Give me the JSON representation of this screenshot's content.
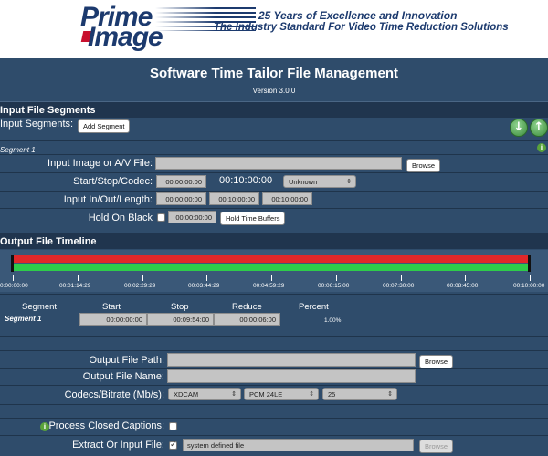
{
  "banner": {
    "logo_line1": "Prime",
    "logo_line2": "Image",
    "tagline1": "25 Years of Excellence and Innovation",
    "tagline2": "The Industry Standard For Video Time Reduction Solutions"
  },
  "page": {
    "title": "Software Time Tailor File Management",
    "version": "Version 3.0.0"
  },
  "input_section": {
    "heading": "Input File Segments",
    "segments_label": "Input Segments:",
    "add_segment_label": "Add Segment",
    "move_down_icon": "↓",
    "move_up_icon": "↑",
    "segment_name": "Segment 1",
    "info_icon": "i",
    "image_av_label": "Input Image or A/V File:",
    "image_av_value": "",
    "browse_label": "Browse",
    "start_stop_label": "Start/Stop/Codec:",
    "start_value": "00:00:00:00",
    "stop_value": "00:10:00:00",
    "codec_value": "Unknown",
    "in_out_label": "Input In/Out/Length:",
    "in_value": "00:00:00:00",
    "out_value": "00:10:00:00",
    "length_value": "00:10:00:00",
    "hold_label": "Hold On Black",
    "hold_value": "00:00:00:00",
    "hold_button_label": "Hold Time Buffers"
  },
  "timeline_section": {
    "heading": "Output File Timeline",
    "ticks": [
      "0:00:00:00",
      "00:01:14:29",
      "00:02:29:29",
      "00:03:44:29",
      "00:04:59:29",
      "00:06:15:00",
      "00:07:30:00",
      "00:08:45:00",
      "00:10:00:00"
    ],
    "table_headers": [
      "Segment",
      "Start",
      "Stop",
      "Reduce",
      "Percent"
    ],
    "rows": [
      {
        "segment": "Segment 1",
        "start": "00:00:00:00",
        "stop": "00:09:54:00",
        "reduce": "00:00:06:00",
        "percent": "1.00%"
      }
    ]
  },
  "output_section": {
    "path_label": "Output File Path:",
    "path_value": "",
    "browse_label": "Browse",
    "name_label": "Output File Name:",
    "name_value": "",
    "codecs_label": "Codecs/Bitrate (Mb/s):",
    "video_codec": "XDCAM",
    "audio_codec": "PCM 24LE",
    "bitrate": "25",
    "captions_label": "Process Closed Captions:",
    "extract_label": "Extract Or Input File:",
    "extract_value": "system defined file",
    "extract_browse_label": "Browse"
  },
  "colors": {
    "background": "#2f4c6b",
    "section_header": "#20354e",
    "timeline_red": "#e0282a",
    "timeline_green": "#2ecc4a"
  }
}
